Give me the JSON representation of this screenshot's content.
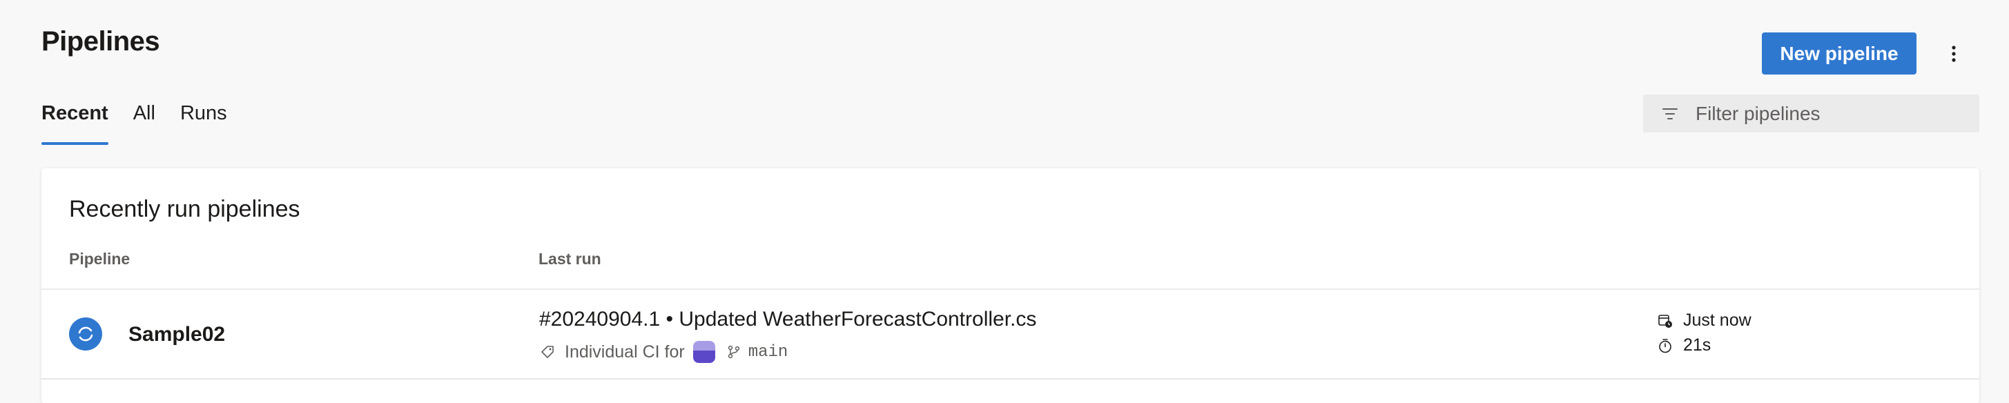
{
  "header": {
    "title": "Pipelines",
    "new_button_label": "New pipeline",
    "more_icon": "more-vertical-icon"
  },
  "tabs": [
    {
      "label": "Recent",
      "active": true
    },
    {
      "label": "All",
      "active": false
    },
    {
      "label": "Runs",
      "active": false
    }
  ],
  "filter": {
    "placeholder": "Filter pipelines",
    "icon": "filter-icon"
  },
  "card": {
    "title": "Recently run pipelines",
    "columns": {
      "pipeline": "Pipeline",
      "last_run": "Last run"
    },
    "rows": [
      {
        "pipeline_name": "Sample02",
        "status_icon": "in-progress-icon",
        "run_title": "#20240904.1 • Updated WeatherForecastController.cs",
        "trigger_text": "Individual CI for",
        "branch": "main",
        "when": "Just now",
        "duration": "21s"
      }
    ]
  },
  "colors": {
    "accent": "#2f78d0",
    "background": "#f8f8f8",
    "card": "#ffffff",
    "secondary_text": "#605e5c",
    "avatar_dark": "#5b48c8",
    "avatar_light": "#a79ce6"
  }
}
